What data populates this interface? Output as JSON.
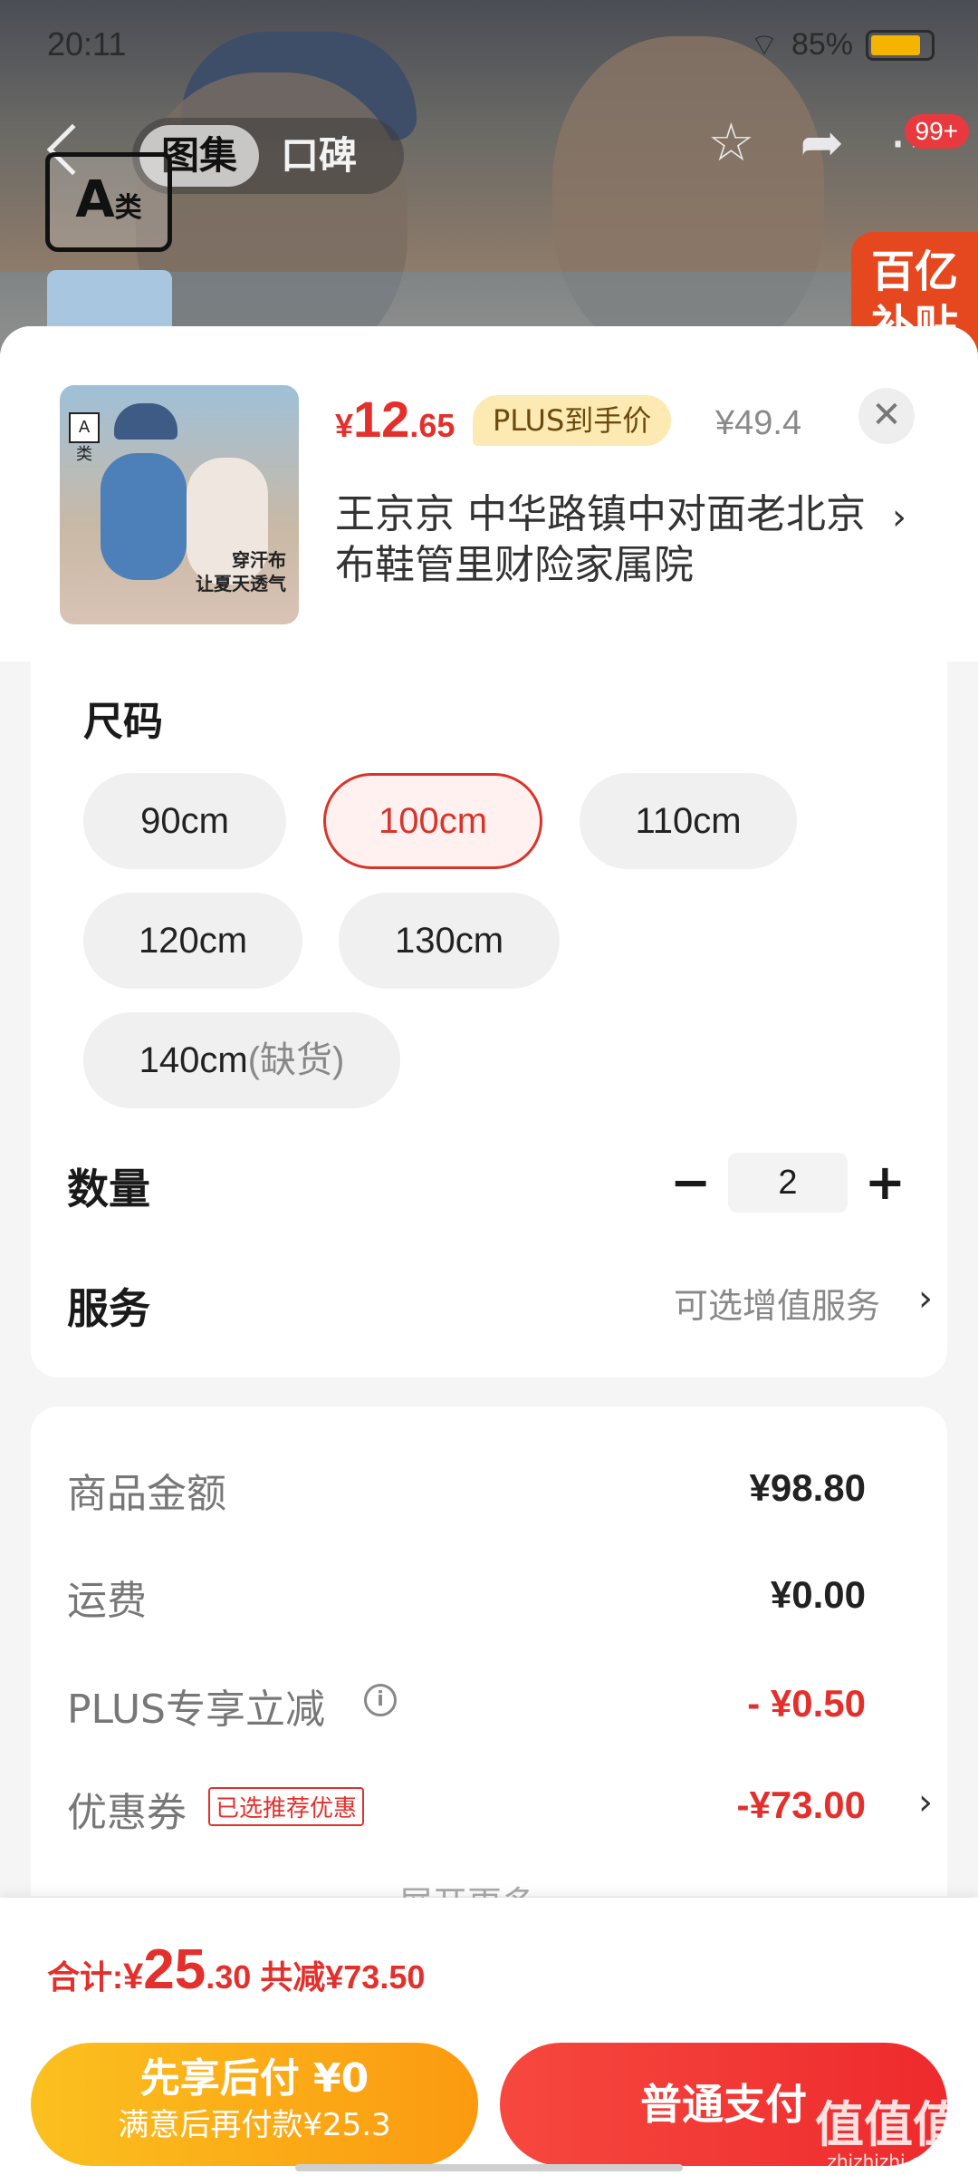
{
  "status_bar": {
    "time": "20:11",
    "battery": "85%"
  },
  "header": {
    "tabs": [
      {
        "label": "图集"
      },
      {
        "label": "口碑"
      }
    ],
    "grade_badge": {
      "main": "A",
      "sub": "类"
    },
    "notification_count": "99+",
    "subsidy_label": "百亿补贴"
  },
  "product": {
    "price_currency": "¥",
    "price_int": "12",
    "price_dec": ".65",
    "plus_label": "PLUS到手价",
    "original_price": "¥49.4",
    "address": "王京京  中华路镇中对面老北京布鞋管里财险家属院",
    "thumb_grade": "A类",
    "thumb_slogan_1": "穿汗布",
    "thumb_slogan_2": "让夏天透气"
  },
  "spec": {
    "title": "尺码",
    "sizes": [
      "90cm",
      "100cm",
      "110cm",
      "120cm",
      "130cm",
      "140cm"
    ],
    "selected_size": "100cm",
    "out_of_stock_note": "(缺货)",
    "quantity_label": "数量",
    "quantity": "2",
    "service_label": "服务",
    "service_value": "可选增值服务"
  },
  "summary": {
    "goods_amount_label": "商品金额",
    "goods_amount": "¥98.80",
    "shipping_label": "运费",
    "shipping": "¥0.00",
    "plus_discount_label": "PLUS专享立减",
    "plus_discount": "- ¥0.50",
    "coupon_label": "优惠券",
    "coupon_tag": "已选推荐优惠",
    "coupon_value": "-¥73.00",
    "expand_label": "展开更多"
  },
  "footer": {
    "total_label": "合计:",
    "total_currency": "¥",
    "total_int": "25",
    "total_dec": ".30",
    "total_saved": "共减¥73.50",
    "pay_later_line1": "先享后付 ¥0",
    "pay_later_line2": "满意后再付款¥25.3",
    "pay_button": "普通支付",
    "watermark": "值值值",
    "watermark_site": "zhizhizhi.com"
  },
  "colors": {
    "accent_red": "#e3302c",
    "plus_gold": "#fde9b2",
    "pay_later_orange": "#fb9a10"
  }
}
